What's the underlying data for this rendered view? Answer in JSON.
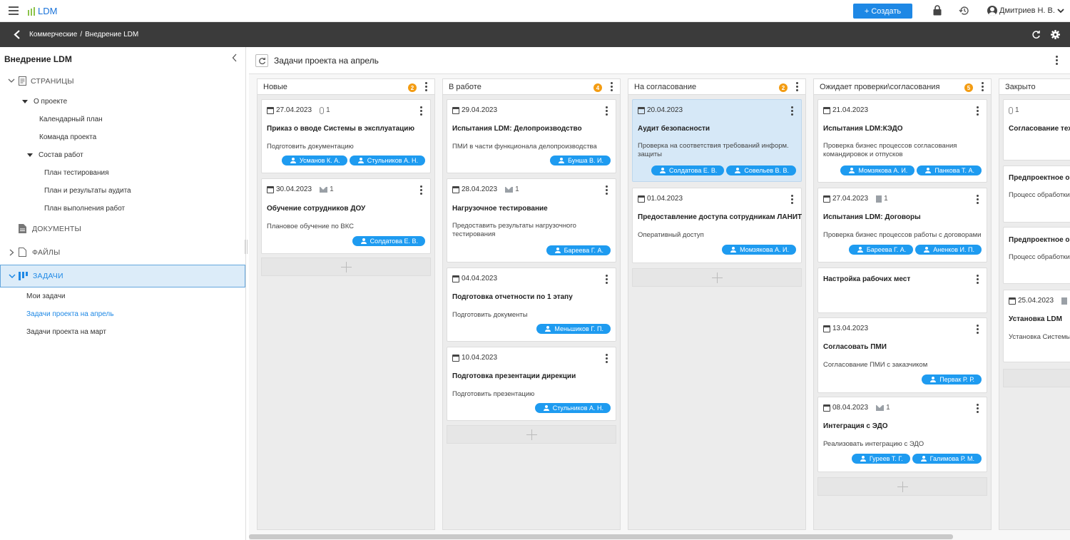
{
  "app": {
    "logo_text": "LDM",
    "create_label": "+ Создать",
    "user_name": "Дмитриев Н. В."
  },
  "breadcrumb": {
    "parent": "Коммерческие",
    "sep": "/",
    "current": "Внедрение LDM"
  },
  "sidebar": {
    "title": "Внедрение LDM",
    "section_pages": "СТРАНИЦЫ",
    "about": "О проекте",
    "calendar": "Календарный план",
    "team": "Команда проекта",
    "works": "Состав работ",
    "test_plan": "План тестирования",
    "audit": "План и результаты аудита",
    "exec_plan": "План выполнения работ",
    "section_docs": "ДОКУМЕНТЫ",
    "section_files": "ФАЙЛЫ",
    "section_tasks": "ЗАДАЧИ",
    "my_tasks": "Мои задачи",
    "april": "Задачи проекта на апрель",
    "march": "Задачи проекта на март"
  },
  "board": {
    "title": "Задачи проекта на апрель",
    "columns": [
      {
        "name": "Новые",
        "count": "2"
      },
      {
        "name": "В работе",
        "count": "4"
      },
      {
        "name": "На согласование",
        "count": "2"
      },
      {
        "name": "Ожидает проверки\\согласования",
        "count": "5"
      },
      {
        "name": "Закрыто"
      }
    ]
  },
  "cards": {
    "c1": {
      "date": "27.04.2023",
      "att": "1",
      "title": "Приказ о вводе Системы в эксплуатацию",
      "desc": "Подготовить документацию",
      "p1": "Усманов К. А.",
      "p2": "Стульников А. Н."
    },
    "c2": {
      "date": "30.04.2023",
      "att": "1",
      "title": "Обучение сотрудников ДОУ",
      "desc": "Плановое обучение по ВКС",
      "p1": "Солдатова Е. В."
    },
    "c3": {
      "date": "29.04.2023",
      "title": "Испытания LDM: Делопроизводство",
      "desc": "ПМИ в части функционала делопроизводства",
      "p1": "Бунша В. И."
    },
    "c4": {
      "date": "28.04.2023",
      "att": "1",
      "title": "Нагрузочное тестирование",
      "desc": "Предоставить результаты нагрузочного тестирования",
      "p1": "Бареева Г. А."
    },
    "c5": {
      "date": "04.04.2023",
      "title": "Подготовка отчетности по 1 этапу",
      "desc": "Подготовить документы",
      "p1": "Меньшиков Г. П."
    },
    "c6": {
      "date": "10.04.2023",
      "title": "Подготовка презентации дирекции",
      "desc": "Подготовить презентацию",
      "p1": "Стульников А. Н."
    },
    "c7": {
      "date": "20.04.2023",
      "title": "Аудит безопасности",
      "desc": "Проверка на соответствия требований информ. защиты",
      "p1": "Солдатова Е. В.",
      "p2": "Совельев В. В."
    },
    "c8": {
      "date": "01.04.2023",
      "title": "Предоставление доступа сотрудникам ЛАНИТ",
      "desc": "Оперативный доступ",
      "p1": "Момзякова А. И."
    },
    "c9": {
      "date": "21.04.2023",
      "title": "Испытания LDM:КЭДО",
      "desc": "Проверка бизнес процессов согласования командировок и отпусков",
      "p1": "Момзякова А. И.",
      "p2": "Панкова Т. А."
    },
    "c10": {
      "date": "27.04.2023",
      "att": "1",
      "title": "Испытания LDM: Договоры",
      "desc": "Проверка бизнес процессов работы с договорами",
      "p1": "Бареева Г. А.",
      "p2": "Аненков И. П."
    },
    "c11": {
      "title": "Настройка рабочих мест"
    },
    "c12": {
      "date": "13.04.2023",
      "title": "Согласовать ПМИ",
      "desc": "Согласование ПМИ с заказчиком",
      "p1": "Первак Р. Р."
    },
    "c13": {
      "date": "08.04.2023",
      "att": "1",
      "title": "Интеграция с ЭДО",
      "desc": "Реализовать интеграцию с ЭДО",
      "p1": "Гуреев Т. Г.",
      "p2": "Галимова Р. М."
    },
    "c14": {
      "att": "1",
      "title": "Согласование техн"
    },
    "c15": {
      "title": "Предпроектное обс",
      "desc": "Процесс обработки"
    },
    "c16": {
      "title": "Предпроектное обс",
      "desc": "Процесс обработки"
    },
    "c17": {
      "date": "25.04.2023",
      "title": "Установка LDM",
      "desc": "Установка Системы"
    }
  },
  "colors": {
    "accent": "#1e88e5",
    "chip": "#1e9bf0",
    "badge": "#f39c12",
    "logo_dots": "#8bc34a",
    "dark_bar": "#3b3b3b"
  }
}
